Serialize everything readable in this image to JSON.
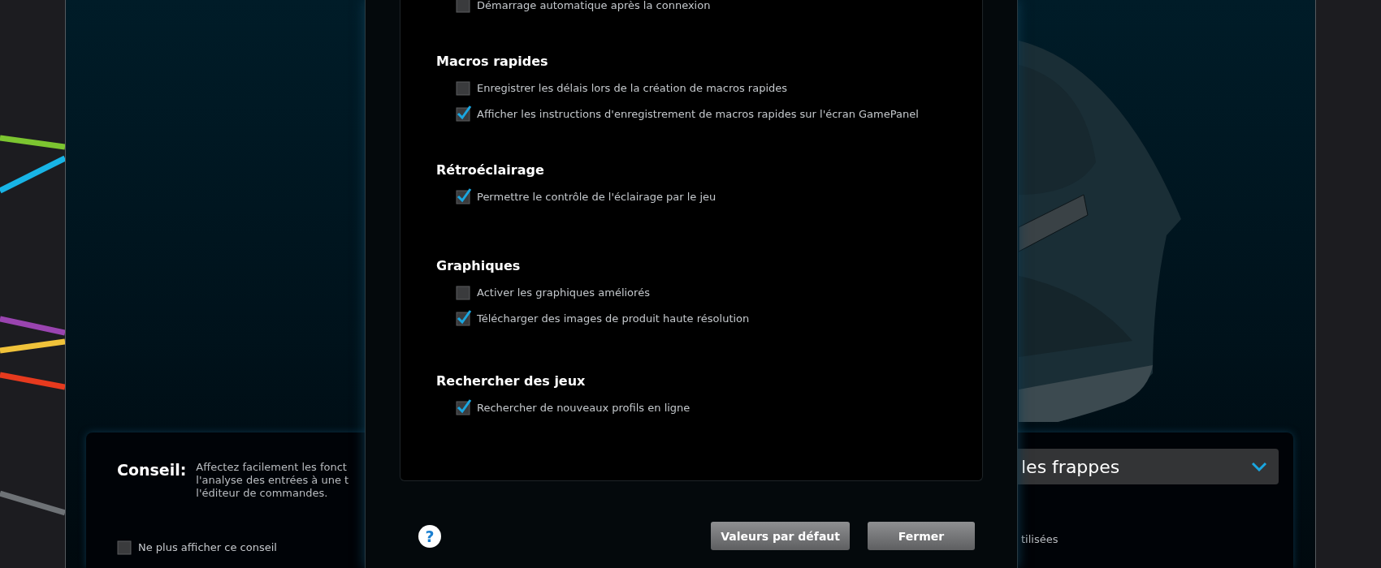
{
  "main_window": {
    "tip": {
      "label": "Conseil:",
      "lines": [
        "Affectez facilement les fonct",
        "l'analyse des entrées à une t",
        "l'éditeur de commandes."
      ],
      "dont_show": {
        "label": "Ne plus afficher ce conseil",
        "checked": false
      }
    },
    "dropdown": {
      "value": "les frappes"
    },
    "option_fragment": "tilisées"
  },
  "dialog": {
    "sections": [
      {
        "items": [
          {
            "label": "Démarrage automatique après la connexion",
            "checked": false
          }
        ]
      },
      {
        "heading": "Macros rapides",
        "items": [
          {
            "label": "Enregistrer les délais lors de la création de macros rapides",
            "checked": false
          },
          {
            "label": "Afficher les instructions d'enregistrement de macros rapides sur l'écran GamePanel",
            "checked": true
          }
        ]
      },
      {
        "heading": "Rétroéclairage",
        "items": [
          {
            "label": "Permettre le contrôle de l'éclairage par le jeu",
            "checked": true
          }
        ]
      },
      {
        "heading": "Graphiques",
        "items": [
          {
            "label": "Activer les graphiques améliorés",
            "checked": false
          },
          {
            "label": "Télécharger des images de produit haute résolution",
            "checked": true
          }
        ]
      },
      {
        "heading": "Rechercher des jeux",
        "items": [
          {
            "label": "Rechercher de nouveaux profils en ligne",
            "checked": true
          }
        ]
      }
    ],
    "help": "?",
    "buttons": [
      "Valeurs par défaut",
      "Fermer"
    ]
  }
}
